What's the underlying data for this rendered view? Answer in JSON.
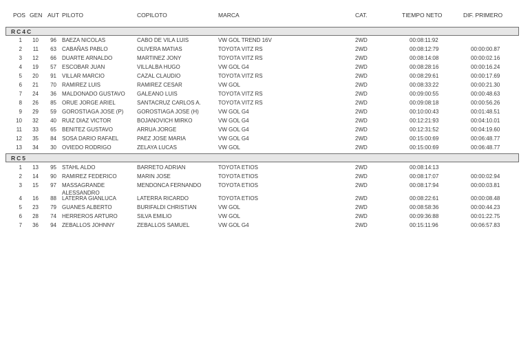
{
  "columns": {
    "pos": "POS",
    "gen": "GEN",
    "aut": "AUT",
    "piloto": "PILOTO",
    "copiloto": "COPILOTO",
    "marca": "MARCA",
    "cat": "CAT.",
    "tiempo": "TIEMPO NETO",
    "dif": "DIF. PRIMERO"
  },
  "sections": [
    {
      "title": "RC4C",
      "rows": [
        {
          "pos": "1",
          "gen": "10",
          "aut": "96",
          "piloto": "BAEZA NICOLAS",
          "copiloto": "CABO DE VILA LUIS",
          "marca": "VW GOL TREND 16V",
          "cat": "2WD",
          "tiempo": "00:08:11:92",
          "dif": ""
        },
        {
          "pos": "2",
          "gen": "11",
          "aut": "63",
          "piloto": "CABAÑAS PABLO",
          "copiloto": "OLIVERA MATIAS",
          "marca": "TOYOTA VITZ RS",
          "cat": "2WD",
          "tiempo": "00:08:12:79",
          "dif": "00:00:00.87"
        },
        {
          "pos": "3",
          "gen": "12",
          "aut": "66",
          "piloto": "DUARTE ARNALDO",
          "copiloto": "MARTINEZ JONY",
          "marca": "TOYOTA VITZ RS",
          "cat": "2WD",
          "tiempo": "00:08:14:08",
          "dif": "00:00:02.16"
        },
        {
          "pos": "4",
          "gen": "19",
          "aut": "57",
          "piloto": "ESCOBAR JUAN",
          "copiloto": "VILLALBA HUGO",
          "marca": "VW GOL G4",
          "cat": "2WD",
          "tiempo": "00:08:28:16",
          "dif": "00:00:16.24"
        },
        {
          "pos": "5",
          "gen": "20",
          "aut": "91",
          "piloto": "VILLAR MARCIO",
          "copiloto": "CAZAL CLAUDIO",
          "marca": "TOYOTA VITZ RS",
          "cat": "2WD",
          "tiempo": "00:08:29:61",
          "dif": "00:00:17.69"
        },
        {
          "pos": "6",
          "gen": "21",
          "aut": "70",
          "piloto": "RAMIREZ LUIS",
          "copiloto": "RAMIREZ CESAR",
          "marca": "VW GOL",
          "cat": "2WD",
          "tiempo": "00:08:33:22",
          "dif": "00:00:21.30"
        },
        {
          "pos": "7",
          "gen": "24",
          "aut": "36",
          "piloto": "MALDONADO GUSTAVO",
          "copiloto": "GALEANO LUIS",
          "marca": "TOYOTA VITZ RS",
          "cat": "2WD",
          "tiempo": "00:09:00:55",
          "dif": "00:00:48.63"
        },
        {
          "pos": "8",
          "gen": "26",
          "aut": "85",
          "piloto": "ORUE JORGE ARIEL",
          "copiloto": "SANTACRUZ CARLOS A.",
          "marca": "TOYOTA VITZ RS",
          "cat": "2WD",
          "tiempo": "00:09:08:18",
          "dif": "00:00:56.26"
        },
        {
          "pos": "9",
          "gen": "29",
          "aut": "59",
          "piloto": "GOROSTIAGA JOSE (P)",
          "copiloto": "GOROSTIAGA JOSE (H)",
          "marca": "VW GOL G4",
          "cat": "2WD",
          "tiempo": "00:10:00:43",
          "dif": "00:01:48.51"
        },
        {
          "pos": "10",
          "gen": "32",
          "aut": "40",
          "piloto": "RUIZ DIAZ VICTOR",
          "copiloto": "BOJANOVICH MIRKO",
          "marca": "VW GOL G4",
          "cat": "2WD",
          "tiempo": "00:12:21:93",
          "dif": "00:04:10.01"
        },
        {
          "pos": "11",
          "gen": "33",
          "aut": "65",
          "piloto": "BENITEZ GUSTAVO",
          "copiloto": "ARRUA JORGE",
          "marca": "VW GOL G4",
          "cat": "2WD",
          "tiempo": "00:12:31:52",
          "dif": "00:04:19.60"
        },
        {
          "pos": "12",
          "gen": "35",
          "aut": "84",
          "piloto": "SOSA DARIO RAFAEL",
          "copiloto": "PAEZ JOSE MARIA",
          "marca": "VW GOL G4",
          "cat": "2WD",
          "tiempo": "00:15:00:69",
          "dif": "00:06:48.77"
        },
        {
          "pos": "13",
          "gen": "34",
          "aut": "30",
          "piloto": "OVIEDO RODRIGO",
          "copiloto": "ZELAYA LUCAS",
          "marca": "VW GOL",
          "cat": "2WD",
          "tiempo": "00:15:00:69",
          "dif": "00:06:48.77"
        }
      ]
    },
    {
      "title": "RC5",
      "rows": [
        {
          "pos": "1",
          "gen": "13",
          "aut": "95",
          "piloto": "STAHL ALDO",
          "copiloto": "BARRETO ADRIAN",
          "marca": "TOYOTA ETIOS",
          "cat": "2WD",
          "tiempo": "00:08:14:13",
          "dif": ""
        },
        {
          "pos": "2",
          "gen": "14",
          "aut": "90",
          "piloto": "RAMIREZ FEDERICO",
          "copiloto": "MARIN JOSE",
          "marca": "TOYOTA ETIOS",
          "cat": "2WD",
          "tiempo": "00:08:17:07",
          "dif": "00:00:02.94"
        },
        {
          "pos": "3",
          "gen": "15",
          "aut": "97",
          "piloto": "MASSAGRANDE ALESSANDRO",
          "copiloto": "MENDONCA FERNANDO",
          "marca": "TOYOTA ETIOS",
          "cat": "2WD",
          "tiempo": "00:08:17:94",
          "dif": "00:00:03.81"
        },
        {
          "pos": "4",
          "gen": "16",
          "aut": "88",
          "piloto": "LATERRA GIANLUCA",
          "copiloto": "LATERRA RICARDO",
          "marca": "TOYOTA ETIOS",
          "cat": "2WD",
          "tiempo": "00:08:22:61",
          "dif": "00:00:08.48"
        },
        {
          "pos": "5",
          "gen": "23",
          "aut": "79",
          "piloto": "GUANES ALBERTO",
          "copiloto": "BURIFALDI CHRISTIAN",
          "marca": "VW GOL",
          "cat": "2WD",
          "tiempo": "00:08:58:36",
          "dif": "00:00:44.23"
        },
        {
          "pos": "6",
          "gen": "28",
          "aut": "74",
          "piloto": "HERREROS ARTURO",
          "copiloto": "SILVA EMILIO",
          "marca": "VW GOL",
          "cat": "2WD",
          "tiempo": "00:09:36:88",
          "dif": "00:01:22.75"
        },
        {
          "pos": "7",
          "gen": "36",
          "aut": "94",
          "piloto": "ZEBALLOS JOHNNY",
          "copiloto": "ZEBALLOS SAMUEL",
          "marca": "VW GOL G4",
          "cat": "2WD",
          "tiempo": "00:15:11:96",
          "dif": "00:06:57.83"
        }
      ]
    }
  ]
}
